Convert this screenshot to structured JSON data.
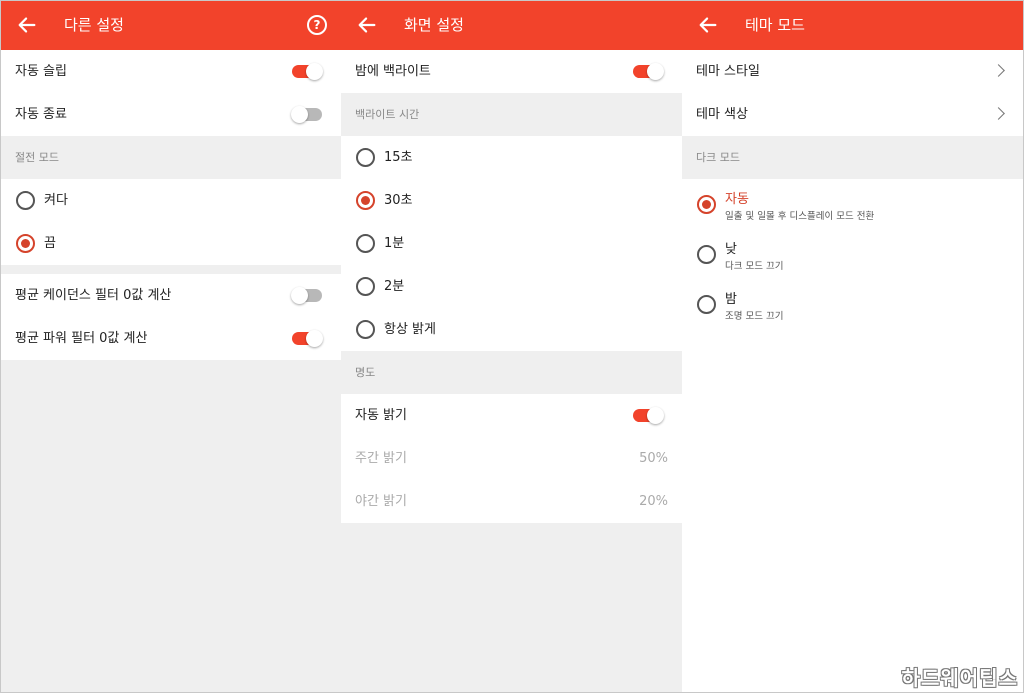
{
  "colors": {
    "accent": "#f2432b",
    "radio_selected": "#d5432b",
    "section_bg": "#efefef"
  },
  "panel1": {
    "title": "다른 설정",
    "help_icon": "?",
    "rows": [
      {
        "label": "자동 슬립",
        "toggle": true
      },
      {
        "label": "자동 종료",
        "toggle": false
      }
    ],
    "section": "절전 모드",
    "radios": [
      {
        "label": "켜다",
        "selected": false
      },
      {
        "label": "끔",
        "selected": true
      }
    ],
    "rows2": [
      {
        "label": "평균 케이던스 필터 0값 계산",
        "toggle": false
      },
      {
        "label": "평균 파워 필터 0값 계산",
        "toggle": true
      }
    ]
  },
  "panel2": {
    "title": "화면 설정",
    "row_top": {
      "label": "밤에 백라이트",
      "toggle": true
    },
    "section1": "백라이트 시간",
    "radios": [
      {
        "label": "15초",
        "selected": false
      },
      {
        "label": "30초",
        "selected": true
      },
      {
        "label": "1분",
        "selected": false
      },
      {
        "label": "2분",
        "selected": false
      },
      {
        "label": "항상 밝게",
        "selected": false
      }
    ],
    "section2": "명도",
    "auto_brightness": {
      "label": "자동 밝기",
      "toggle": true
    },
    "day_brightness": {
      "label": "주간 밝기",
      "value": "50%"
    },
    "night_brightness": {
      "label": "야간 밝기",
      "value": "20%"
    }
  },
  "panel3": {
    "title": "테마 모드",
    "rows": [
      {
        "label": "테마 스타일"
      },
      {
        "label": "테마 색상"
      }
    ],
    "section": "다크 모드",
    "radios": [
      {
        "label": "자동",
        "sub": "일출 및 일몰 후 디스플레이 모드 전환",
        "selected": true
      },
      {
        "label": "낮",
        "sub": "다크 모드 끄기",
        "selected": false
      },
      {
        "label": "밤",
        "sub": "조명 모드 끄기",
        "selected": false
      }
    ]
  },
  "watermark": "하드웨어팁스"
}
